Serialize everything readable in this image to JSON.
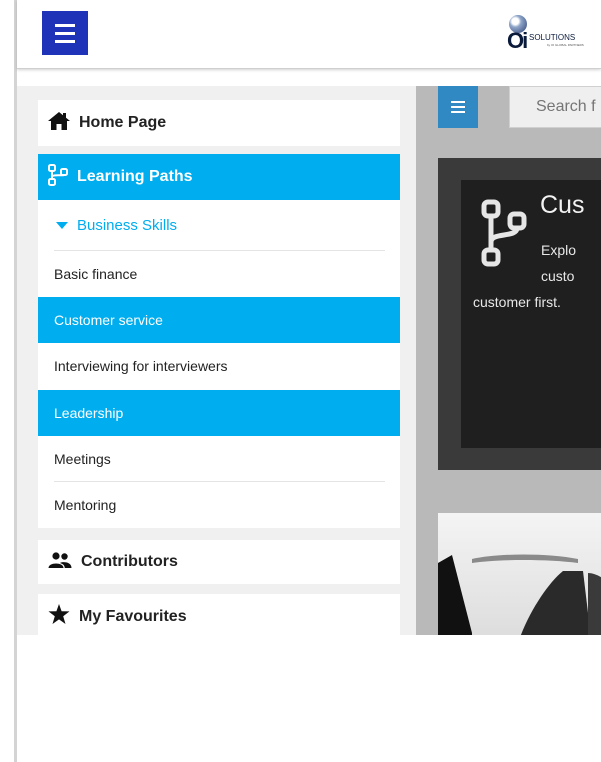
{
  "app": {
    "brand": {
      "mark": "Oi",
      "word": "SOLUTIONS",
      "tagline": "by OI GLOBAL PARTNERS"
    }
  },
  "sidebar": {
    "home_label": "Home Page",
    "learning_paths_label": "Learning Paths",
    "group_label": "Business Skills",
    "items": [
      {
        "label": "Basic finance",
        "selected": false
      },
      {
        "label": "Customer service",
        "selected": true
      },
      {
        "label": "Interviewing for interviewers",
        "selected": false
      },
      {
        "label": "Leadership",
        "selected": true
      },
      {
        "label": "Meetings",
        "selected": false
      },
      {
        "label": "Mentoring",
        "selected": false
      }
    ],
    "contributors_label": "Contributors",
    "favourites_label": "My Favourites"
  },
  "main": {
    "search_placeholder": "Search f",
    "card": {
      "title": "Cus",
      "desc_line1": "Explo",
      "desc_line2": "custo",
      "desc_line3": "customer first."
    }
  },
  "colors": {
    "accent": "#00adef",
    "header_button": "#1f33b8",
    "menu_button": "#3189c4"
  }
}
